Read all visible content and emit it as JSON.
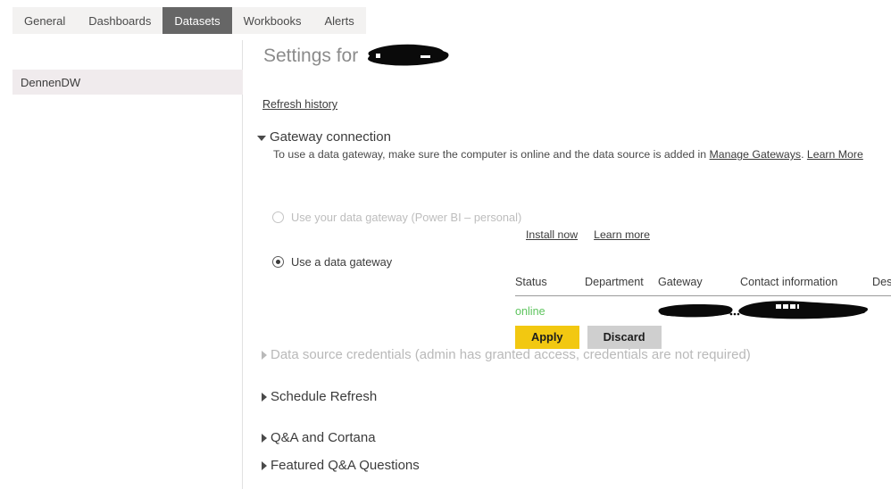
{
  "tabs": [
    {
      "label": "General",
      "selected": false
    },
    {
      "label": "Dashboards",
      "selected": false
    },
    {
      "label": "Datasets",
      "selected": true
    },
    {
      "label": "Workbooks",
      "selected": false
    },
    {
      "label": "Alerts",
      "selected": false
    }
  ],
  "sidebar": {
    "items": [
      {
        "label": "DennenDW",
        "selected": true
      }
    ]
  },
  "main": {
    "page_title": "Settings for",
    "page_title_redacted": true,
    "refresh_history_link": "Refresh history",
    "gateway_section": {
      "title": "Gateway connection",
      "expanded": true,
      "description_prefix": "To use a data gateway, make sure the computer is online and the data source is added in ",
      "description_link_1": "Manage Gateways",
      "description_separator": ". ",
      "description_link_2": "Learn More",
      "options": [
        {
          "label": "Use your data gateway (Power BI – personal)",
          "selected": false,
          "disabled": true
        },
        {
          "label": "Use a data gateway",
          "selected": true,
          "disabled": false
        }
      ],
      "personal_links": [
        {
          "label": "Install now"
        },
        {
          "label": "Learn more"
        }
      ],
      "table": {
        "columns": [
          "Status",
          "Department",
          "Gateway",
          "Contact information",
          "Description"
        ],
        "rows": [
          {
            "status": "online",
            "department": "",
            "gateway": "",
            "gateway_redacted": true,
            "contact_information": "",
            "contact_redacted": true,
            "description": ""
          }
        ]
      },
      "buttons": {
        "apply": "Apply",
        "discard": "Discard"
      }
    },
    "collapsed_sections": [
      {
        "title": "Data source credentials (admin has granted access, credentials are not required)",
        "muted": true
      },
      {
        "title": "Schedule Refresh",
        "muted": false
      },
      {
        "title": "Q&A and Cortana",
        "muted": false
      },
      {
        "title": "Featured Q&A Questions",
        "muted": false
      }
    ]
  },
  "colors": {
    "accent_apply": "#f2c811",
    "selected_tab": "#666666",
    "status_online": "#5ec45e",
    "sidebar_selected": "#f0ebed"
  }
}
